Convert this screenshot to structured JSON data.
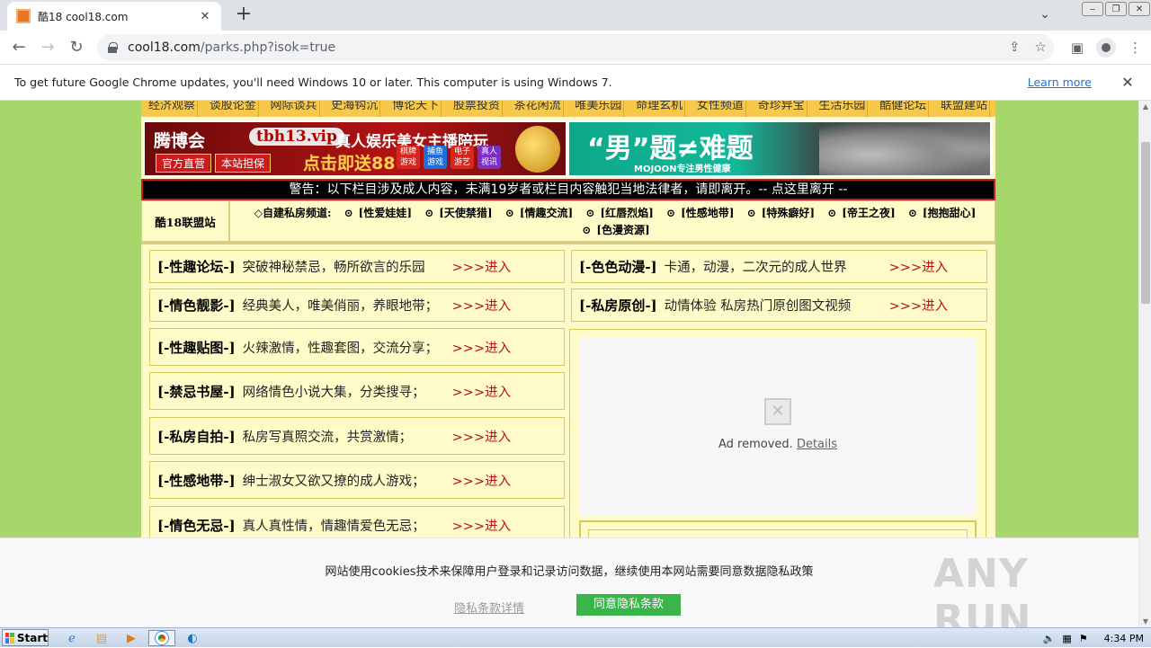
{
  "browser": {
    "tab_title": "酷18 cool18.com",
    "url_host": "cool18.com",
    "url_path": "/parks.php?isok=true"
  },
  "infobar": {
    "text": "To get future Google Chrome updates, you'll need Windows 10 or later. This computer is using Windows 7.",
    "learn_more": "Learn more"
  },
  "nav_items": [
    "经济观察",
    "谈股论金",
    "网际谈兵",
    "史海钩沉",
    "博论天下",
    "股票投资",
    "茶花闲流",
    "唯美乐园",
    "命理玄机",
    "女性频道",
    "奇珍异宝",
    "生活乐园",
    "酷健论坛",
    "联盟建站"
  ],
  "banner_left": {
    "brand": "腾博会",
    "url": "tbh13.vip",
    "slogan": "真人娱乐美女主播陪玩",
    "tag1": "官方直营",
    "tag2": "本站担保",
    "promo": "点击即送88",
    "icons": [
      "棋牌游戏",
      "捕鱼游戏",
      "电子游艺",
      "真人视讯"
    ]
  },
  "banner_right": {
    "title": "“男”题≠难题",
    "subtitle": "MOJOON专注男性健康"
  },
  "warning": "警告：以下栏目涉及成人内容，未满19岁者或栏目内容触犯当地法律者，请即离开。-- 点这里离开 --",
  "union": {
    "title": "酷18联盟站",
    "label": "◇自建私房频道:",
    "links": [
      "[性爱娃娃]",
      "[天使禁猎]",
      "[情趣交流]",
      "[红唇烈焰]",
      "[性感地带]",
      "[特殊癖好]",
      "[帝王之夜]",
      "[抱抱甜心]",
      "[色漫资源]"
    ]
  },
  "enter_label": ">>>进入",
  "left_cards": [
    {
      "title": "[-性趣论坛-]",
      "desc": "突破神秘禁忌，畅所欲言的乐园"
    },
    {
      "title": "[-情色靓影-]",
      "desc": "经典美人，唯美俏丽，养眼地带；"
    },
    {
      "title": "[-性趣贴图-]",
      "desc": "火辣激情，性趣套图，交流分享；"
    },
    {
      "title": "[-禁忌书屋-]",
      "desc": "网络情色小说大集，分类搜寻；"
    },
    {
      "title": "[-私房自拍-]",
      "desc": "私房写真照交流，共赏激情；"
    },
    {
      "title": "[-性感地带-]",
      "desc": "绅士淑女又欲又撩的成人游戏；"
    },
    {
      "title": "[-情色无忌-]",
      "desc": "真人真性情，情趣情爱色无忌；"
    }
  ],
  "right_cards": [
    {
      "title": "[-色色动漫-]",
      "desc": "卡通，动漫，二次元的成人世界"
    },
    {
      "title": "[-私房原创-]",
      "desc": "动情体验 私房热门原创图文视频"
    }
  ],
  "ad": {
    "removed_text": "Ad removed.",
    "details": "Details"
  },
  "cookie": {
    "text": "网站使用cookies技术来保障用户登录和记录访问数据，继续使用本网站需要同意数据隐私政策",
    "details": "隐私条款详情",
    "agree": "同意隐私条款"
  },
  "watermark": "ANY RUN",
  "taskbar": {
    "start": "Start",
    "time": "4:34 PM"
  }
}
